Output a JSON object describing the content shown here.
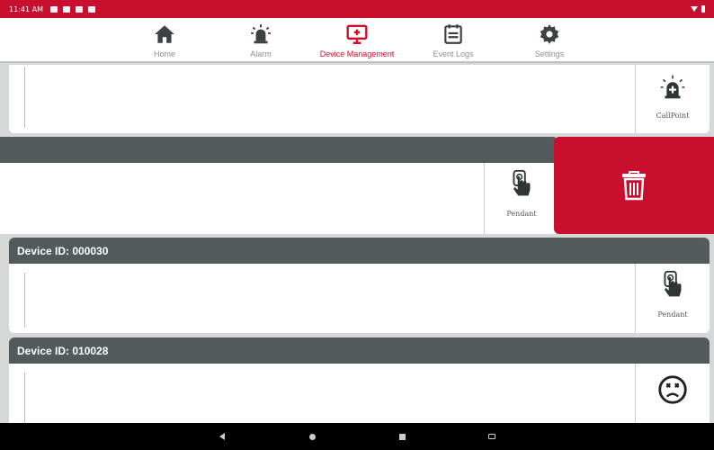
{
  "status_bar": {
    "time": "11:41 AM"
  },
  "nav": {
    "items": [
      {
        "label": "Home",
        "icon": "home-icon",
        "active": false
      },
      {
        "label": "Alarm",
        "icon": "alarm-icon",
        "active": false
      },
      {
        "label": "Device Management",
        "icon": "device-management-icon",
        "active": true
      },
      {
        "label": "Event Logs",
        "icon": "event-logs-icon",
        "active": false
      },
      {
        "label": "Settings",
        "icon": "settings-icon",
        "active": false
      }
    ]
  },
  "devices": [
    {
      "header": "",
      "type_label": "CallPoint",
      "icon": "callpoint-icon"
    },
    {
      "header": "",
      "type_label": "Pendant",
      "icon": "pendant-icon",
      "swiped": true,
      "action_icon": "delete-icon"
    },
    {
      "header": "Device ID: 000030",
      "type_label": "Pendant",
      "icon": "pendant-icon"
    },
    {
      "header": "Device ID: 010028",
      "type_label": "",
      "icon": "unknown-face-icon"
    }
  ],
  "colors": {
    "brand": "#c8102e",
    "header_bg": "#525a5b",
    "page_bg": "#d6d8d8"
  }
}
